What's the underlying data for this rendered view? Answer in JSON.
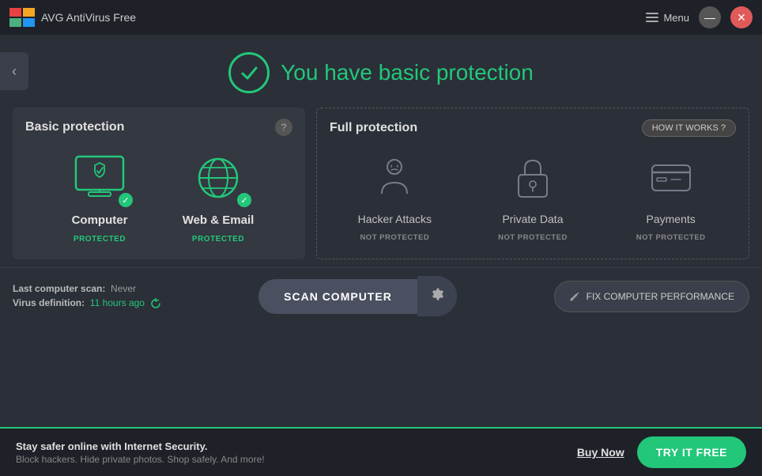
{
  "titleBar": {
    "appName": "AVG AntiVirus Free",
    "menuLabel": "Menu",
    "minimizeTitle": "Minimize",
    "closeTitle": "Close"
  },
  "header": {
    "statusText": "You have basic protection",
    "backLabel": "‹"
  },
  "basicPanel": {
    "title": "Basic protection",
    "helpLabel": "?",
    "items": [
      {
        "name": "Computer",
        "status": "PROTECTED",
        "protected": true
      },
      {
        "name": "Web & Email",
        "status": "PROTECTED",
        "protected": true
      }
    ]
  },
  "fullPanel": {
    "title": "Full protection",
    "howItWorksLabel": "HOW IT WORKS ?",
    "items": [
      {
        "name": "Hacker Attacks",
        "status": "NOT PROTECTED"
      },
      {
        "name": "Private Data",
        "status": "NOT PROTECTED"
      },
      {
        "name": "Payments",
        "status": "NOT PROTECTED"
      }
    ]
  },
  "scanBar": {
    "lastScanLabel": "Last computer scan:",
    "lastScanValue": "Never",
    "virusDefLabel": "Virus definition:",
    "virusDefValue": "11 hours ago",
    "scanBtnLabel": "SCAN COMPUTER",
    "fixBtnLabel": "FIX COMPUTER PERFORMANCE"
  },
  "bottomBanner": {
    "title": "Stay safer online with Internet Security.",
    "subtitle": "Block hackers. Hide private photos. Shop safely. And more!",
    "buyNowLabel": "Buy Now",
    "tryFreeLabel": "TRY IT FREE"
  }
}
